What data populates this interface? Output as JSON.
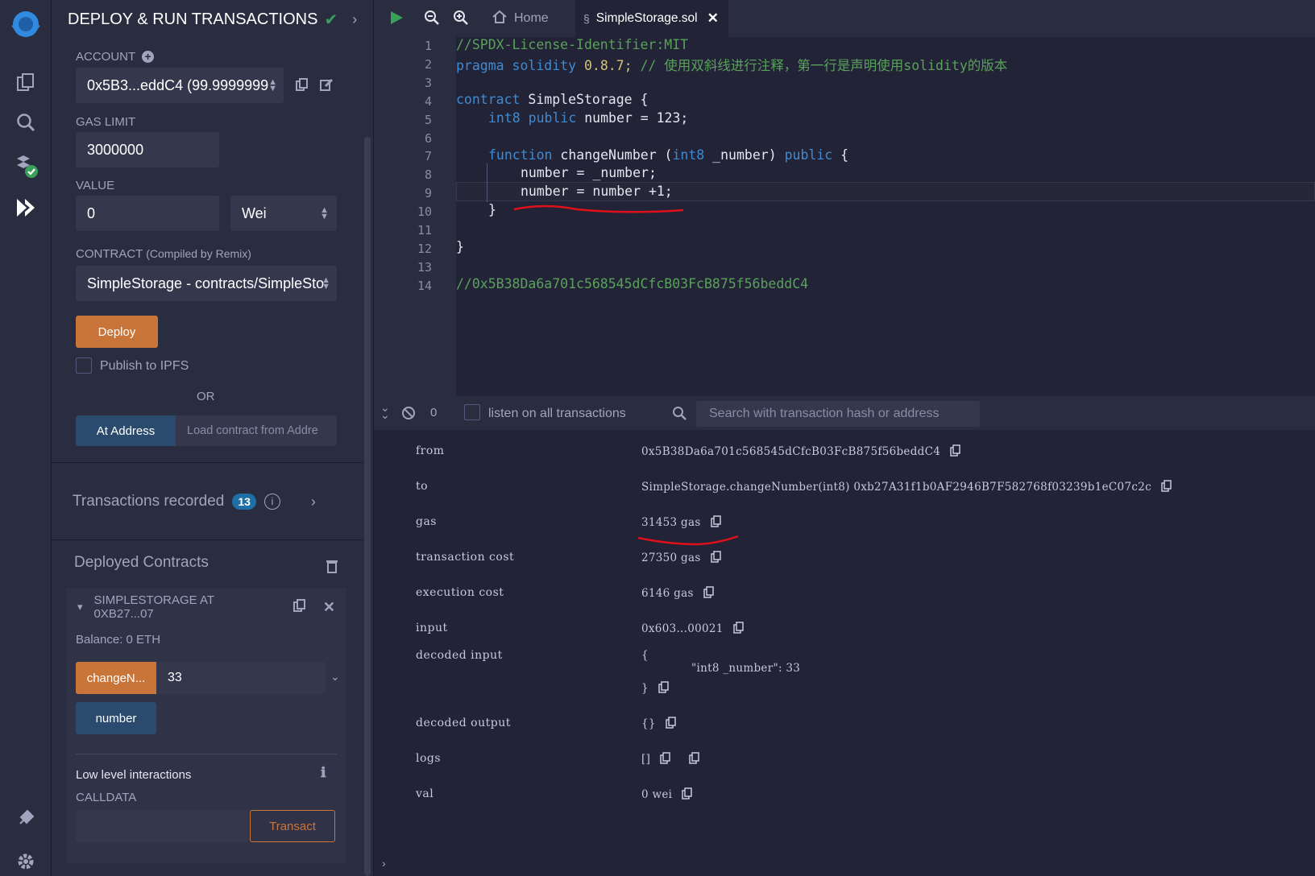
{
  "panel": {
    "title": "DEPLOY & RUN TRANSACTIONS",
    "account_label": "ACCOUNT",
    "account_value": "0x5B3...eddC4 (99.9999999",
    "gas_limit_label": "GAS LIMIT",
    "gas_limit_value": "3000000",
    "value_label": "VALUE",
    "value_value": "0",
    "value_unit": "Wei",
    "contract_label": "CONTRACT",
    "contract_sub": "(Compiled by Remix)",
    "contract_value": "SimpleStorage - contracts/SimpleSto",
    "deploy_label": "Deploy",
    "publish_label": "Publish to IPFS",
    "or_label": "OR",
    "at_address_label": "At Address",
    "load_contract_placeholder": "Load contract from Addre",
    "transactions_recorded_label": "Transactions recorded",
    "transactions_count": "13",
    "deployed_label": "Deployed Contracts",
    "instance_label": "SIMPLESTORAGE AT 0XB27...07",
    "balance_label": "Balance: 0 ETH",
    "change_button": "changeN...",
    "change_input": "33",
    "number_button": "number",
    "low_level_label": "Low level interactions",
    "calldata_label": "CALLDATA",
    "transact_label": "Transact"
  },
  "tabs": {
    "home": "Home",
    "file": "SimpleStorage.sol"
  },
  "editor": {
    "line_numbers": [
      "1",
      "2",
      "3",
      "4",
      "5",
      "6",
      "7",
      "8",
      "9",
      "10",
      "11",
      "12",
      "13",
      "14"
    ],
    "l1": "//SPDX-License-Identifier:MIT",
    "l2_kw": "pragma solidity",
    "l2_ver": " 0.8.7;",
    "l2_cm": " // 使用双斜线进行注释，第一行是声明使用solidity的版本",
    "l4_kw": "contract",
    "l4_rest": " SimpleStorage {",
    "l5_kw": "int8 public",
    "l5_rest": " number = 123;",
    "l7_kw": "function",
    "l7_name": " changeNumber (",
    "l7_kw2": "int8",
    "l7_arg": " _number) ",
    "l7_kw3": "public",
    "l7_end": " {",
    "l8": "number = _number;",
    "l9": "number = number +1;",
    "l10": "}",
    "l12": "}",
    "l14": "//0x5B38Da6a701c568545dCfcB03FcB875f56beddC4"
  },
  "terminal": {
    "count": "0",
    "listen_label": "listen on all transactions",
    "search_placeholder": "Search with transaction hash or address",
    "rows": {
      "from_k": "from",
      "from_v": "0x5B38Da6a701c568545dCfcB03FcB875f56beddC4",
      "to_k": "to",
      "to_v": "SimpleStorage.changeNumber(int8) 0xb27A31f1b0AF2946B7F582768f03239b1eC07c2c",
      "gas_k": "gas",
      "gas_v": "31453 gas",
      "tc_k": "transaction cost",
      "tc_v": "27350 gas",
      "ec_k": "execution cost",
      "ec_v": "6146 gas",
      "in_k": "input",
      "in_v": "0x603...00021",
      "di_k": "decoded input",
      "di_open": "{",
      "di_body": "\"int8 _number\": 33",
      "di_close": "}",
      "do_k": "decoded output",
      "do_v": "{}",
      "logs_k": "logs",
      "logs_v": "[]",
      "val_k": "val",
      "val_v": "0 wei"
    }
  },
  "colors": {
    "accent_orange": "#c97539",
    "accent_blue": "#2a4b6e",
    "annotation_red": "#e0101a",
    "badge": "#1d6fa5"
  }
}
